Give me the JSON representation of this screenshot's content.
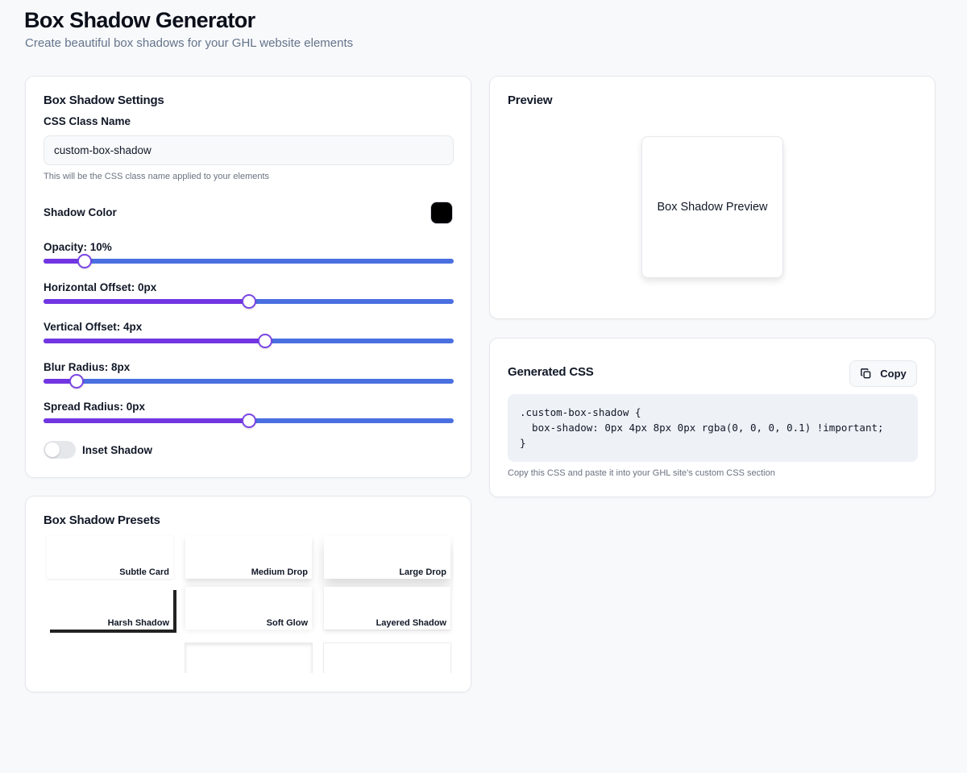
{
  "header": {
    "title": "Box Shadow Generator",
    "subtitle": "Create beautiful box shadows for your GHL website elements"
  },
  "settings": {
    "title": "Box Shadow Settings",
    "class_label": "CSS Class Name",
    "class_value": "custom-box-shadow",
    "class_hint": "This will be the CSS class name applied to your elements",
    "color_label": "Shadow Color",
    "color_value": "#000000",
    "sliders": [
      {
        "label": "Opacity: 10%",
        "fraction": 0.1
      },
      {
        "label": "Horizontal Offset: 0px",
        "fraction": 0.5
      },
      {
        "label": "Vertical Offset: 4px",
        "fraction": 0.54
      },
      {
        "label": "Blur Radius: 8px",
        "fraction": 0.08
      },
      {
        "label": "Spread Radius: 0px",
        "fraction": 0.5
      }
    ],
    "inset_label": "Inset Shadow",
    "inset_enabled": false
  },
  "preview": {
    "title": "Preview",
    "box_label": "Box Shadow Preview"
  },
  "generated": {
    "title": "Generated CSS",
    "copy_label": "Copy",
    "code_lines": [
      ".custom-box-shadow {",
      "  box-shadow: 0px 4px 8px 0px rgba(0, 0, 0, 0.1) !important;",
      "}"
    ],
    "hint": "Copy this CSS and paste it into your GHL site's custom CSS section"
  },
  "presets": {
    "title": "Box Shadow Presets",
    "items": [
      {
        "name": "Subtle Card"
      },
      {
        "name": "Medium Drop"
      },
      {
        "name": "Large Drop"
      },
      {
        "name": "Harsh Shadow"
      },
      {
        "name": "Soft Glow"
      },
      {
        "name": "Layered Shadow"
      },
      {
        "name": ""
      },
      {
        "name": ""
      },
      {
        "name": ""
      }
    ]
  },
  "colors": {
    "slider_fill": "#7136e2",
    "slider_track": "#4a6fe0",
    "accent": "#7a45e4"
  }
}
